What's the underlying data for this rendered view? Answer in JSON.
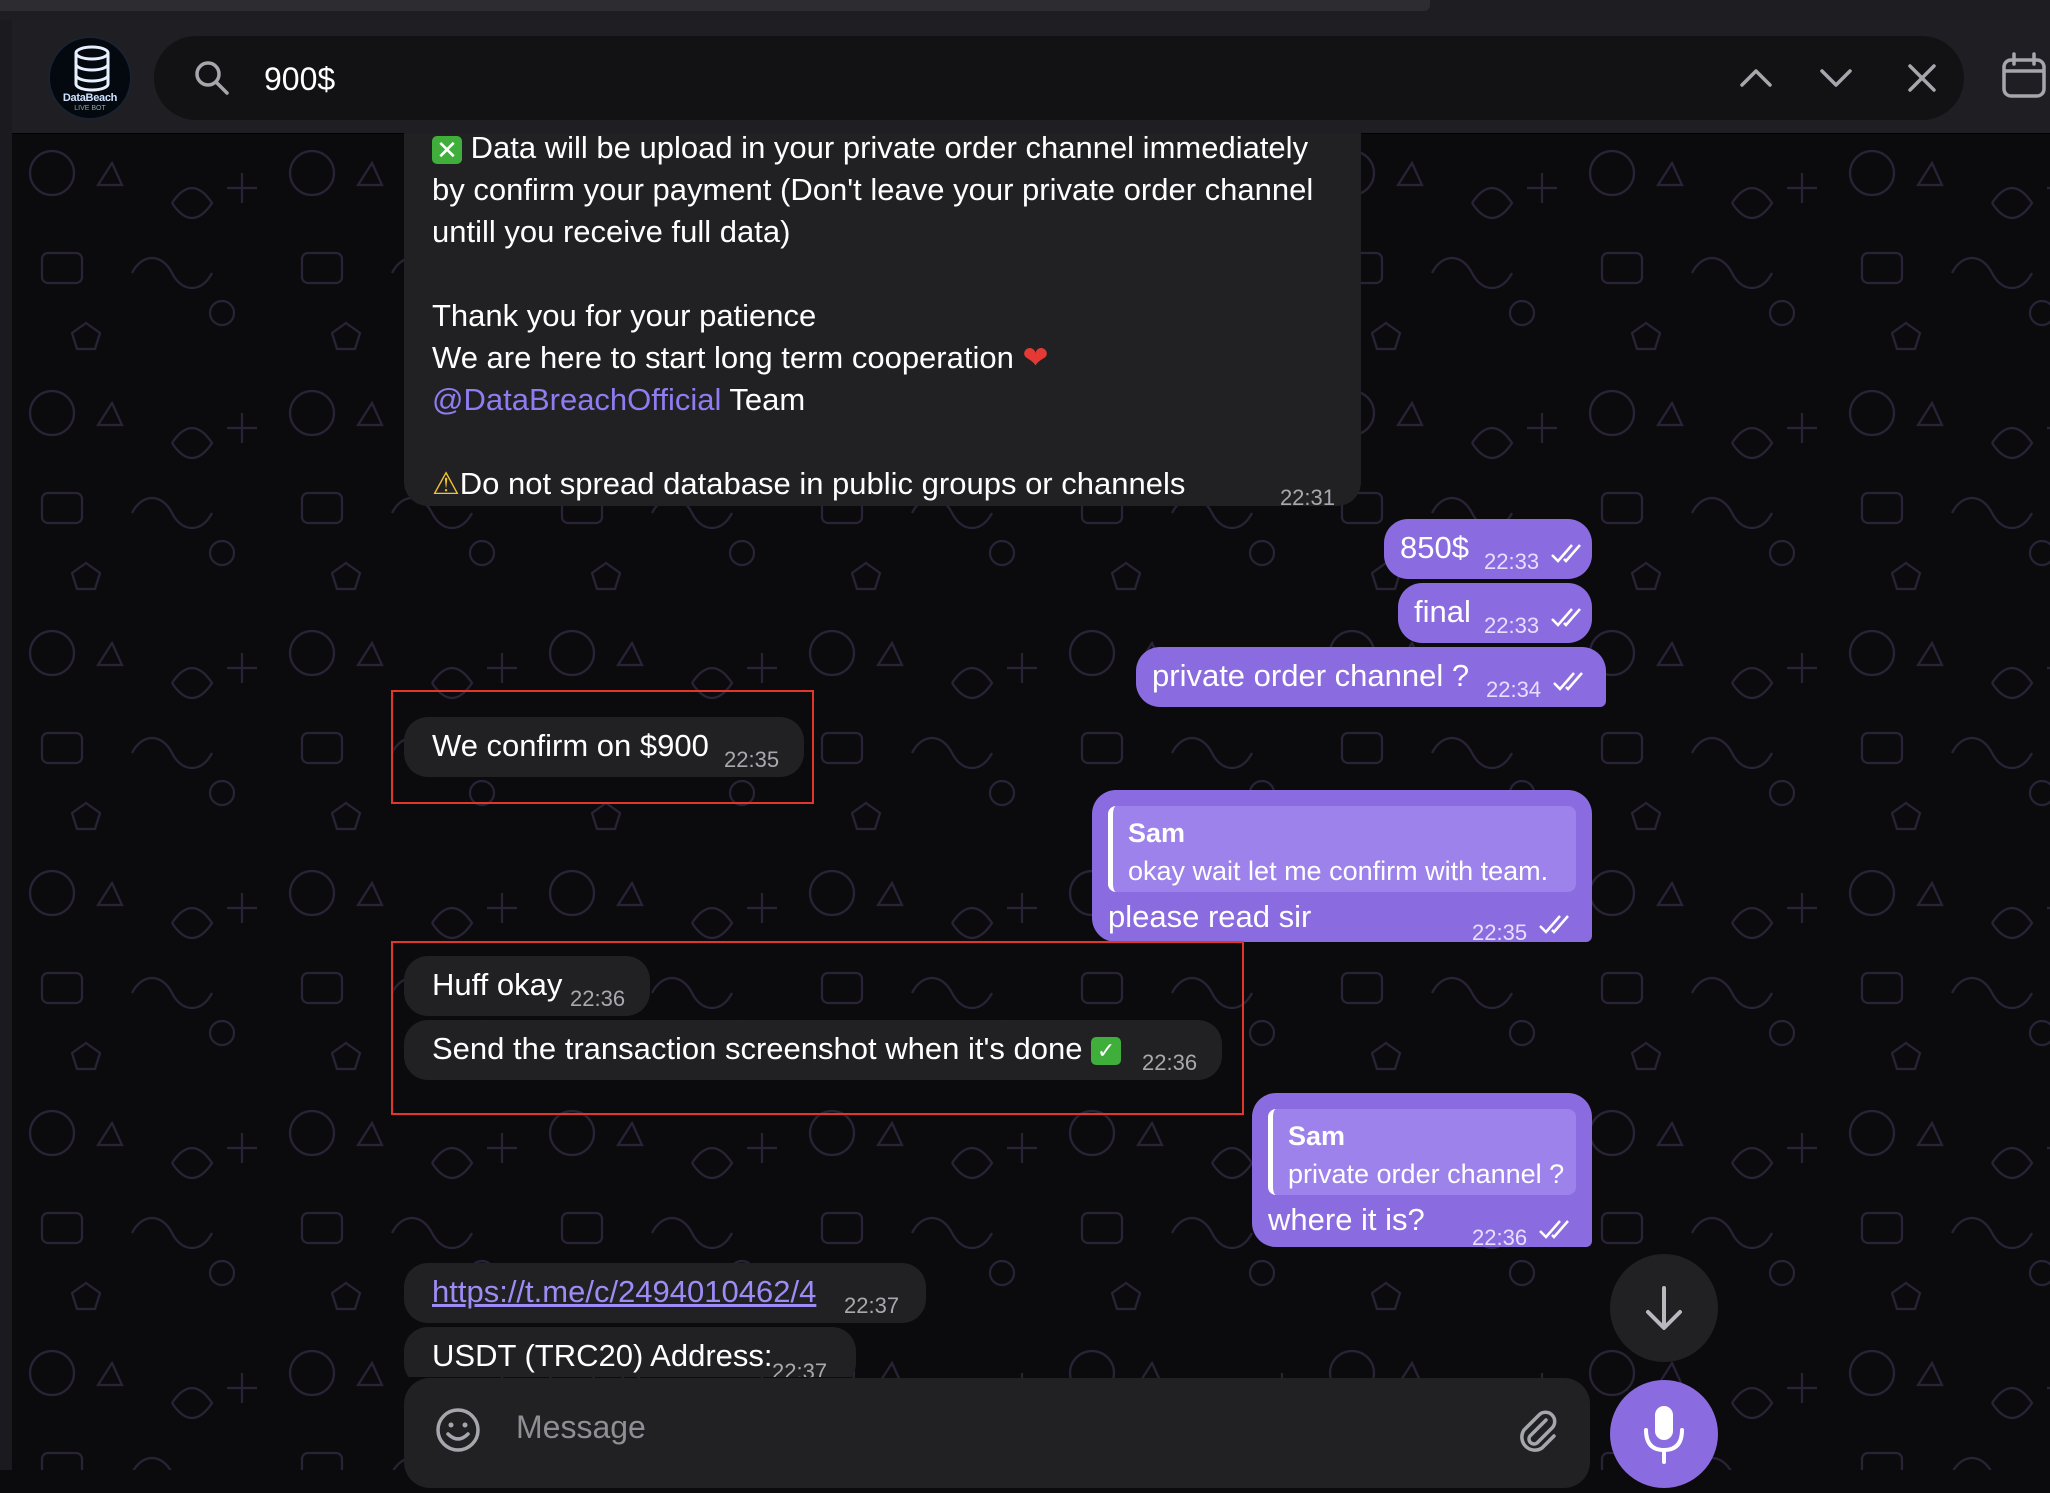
{
  "header": {
    "avatar": {
      "brand": "DataBeach",
      "sub": "LIVE BOT"
    },
    "search": {
      "value": "900$"
    },
    "icons": [
      "search-icon",
      "chevron-up-icon",
      "chevron-down-icon",
      "close-icon",
      "calendar-icon"
    ]
  },
  "messages": {
    "big": {
      "line1": "Data will be upload in your private order channel immediately",
      "line2": "by confirm your payment (Don't leave your private order channel",
      "line3": "untill you receive full data)",
      "line4": "Thank you for your patience",
      "line5": "We are here to start long term cooperation",
      "mention": "@DataBreachOfficial",
      "line6_rest": " Team",
      "line7": "Do not spread database in public groups or channels",
      "time": "22:31"
    },
    "out1": {
      "text": "850$",
      "time": "22:33"
    },
    "out2": {
      "text": "final",
      "time": "22:33"
    },
    "out3": {
      "text": "private order channel ?",
      "time": "22:34"
    },
    "in1": {
      "text": "We confirm on $900",
      "time": "22:35"
    },
    "out4": {
      "quote_name": "Sam",
      "quote_text": "okay wait let me confirm with team.",
      "text": "please read sir",
      "time": "22:35"
    },
    "in2": {
      "text": "Huff okay",
      "time": "22:36"
    },
    "in3": {
      "text": "Send the transaction screenshot when it's done",
      "time": "22:36"
    },
    "out5": {
      "quote_name": "Sam",
      "quote_text": "private order channel ?",
      "text": "where it is?",
      "time": "22:36"
    },
    "in4": {
      "text": "https://t.me/c/2494010462/4",
      "time": "22:37"
    },
    "in5": {
      "text": "USDT (TRC20) Address:",
      "time": "22:37"
    }
  },
  "composer": {
    "placeholder": "Message"
  },
  "colors": {
    "outgoing": "#8b6be0",
    "incoming": "#212124",
    "highlight_box": "#e0362c",
    "link": "#8f7cf0"
  }
}
